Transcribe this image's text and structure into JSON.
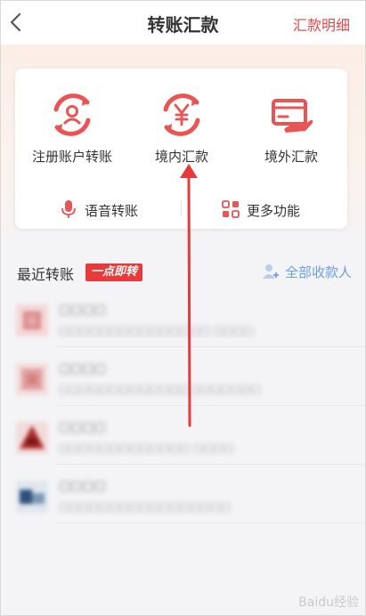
{
  "header": {
    "title": "转账汇款",
    "right_link": "汇款明细"
  },
  "functions": [
    {
      "label": "注册账户转账",
      "icon": "registered-account-transfer-icon"
    },
    {
      "label": "境内汇款",
      "icon": "domestic-remittance-icon"
    },
    {
      "label": "境外汇款",
      "icon": "overseas-remittance-icon"
    }
  ],
  "quick": [
    {
      "label": "语音转账",
      "icon": "microphone-icon"
    },
    {
      "label": "更多功能",
      "icon": "grid-more-icon"
    }
  ],
  "recent": {
    "title": "最近转账",
    "badge": "一点即转",
    "all_payees": "全部收款人"
  },
  "contacts": [
    {
      "name": "▢▢▢▢",
      "desc": "▢▢▢▢▢▢▢▢▢▢▢▢▢▢▢ ▢▢▢▢"
    },
    {
      "name": "▢▢▢▢",
      "desc": "▢▢▢▢▢▢▢▢▢▢▢▢▢▢▢▢▢▢▢▢"
    },
    {
      "name": "▢▢▢▢",
      "desc": "▢▢▢▢▢▢▢▢▢▢▢▢▢ ▢▢▢▢"
    },
    {
      "name": "▢▢▢▢",
      "desc": "▢▢▢▢▢▢▢▢▢▢▢▢▢▢▢▢▢"
    }
  ],
  "watermark": "Baidu经验",
  "colors": {
    "accent": "#e24a4a",
    "link": "#6d9ee8",
    "icon_red": "#e84a4a"
  }
}
